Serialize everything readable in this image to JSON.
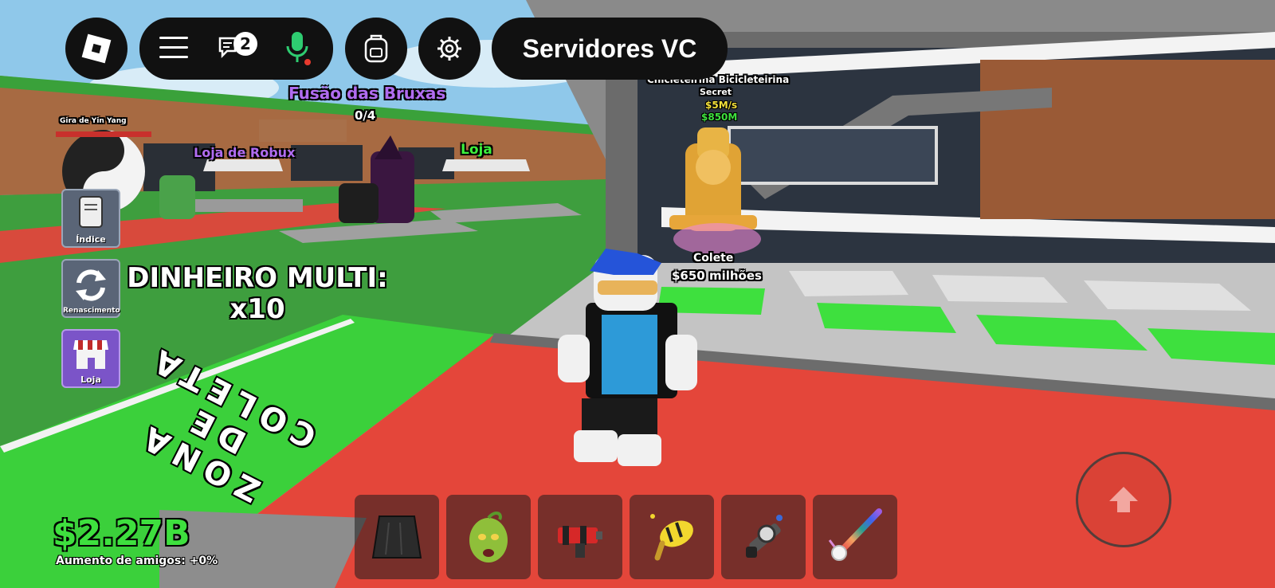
{
  "top_bar": {
    "chat_badge_count": "2",
    "server_button_label": "Servidores VC"
  },
  "world_labels": {
    "witch_fusion_title": "Fusão das Bruxas",
    "witch_fusion_progress": "0/4",
    "robux_shop": "Loja de Robux",
    "shop": "Loja",
    "yin_yang_spin": "Gira de Yin Yang",
    "brainrot_name": "Chicleteirina Bicicleteirina",
    "brainrot_rarity": "Secret",
    "brainrot_rate": "$5M/s",
    "brainrot_price": "$850M",
    "collect_label": "Colete",
    "collect_amount": "$650 milhões"
  },
  "side_menu": {
    "index_label": "Índice",
    "rebirth_label": "Renascimento",
    "shop_label": "Loja"
  },
  "money_multi": {
    "line1": "DINHEIRO MULTI:",
    "line2": "x10"
  },
  "floor_text": {
    "line1": "ZONA",
    "line2": "DE",
    "line3": "COLETA"
  },
  "stats": {
    "cash": "$2.27B",
    "friend_boost": "Aumento de amigos: +0%"
  },
  "hotbar": {
    "slots": [
      "cape",
      "zombie-head",
      "red-blaster",
      "bee-launcher",
      "web-slinger",
      "unicorn-rainbow-sword"
    ]
  },
  "colors": {
    "hud_bg": "#111111",
    "cash_green": "#3ee03e",
    "mic_green": "#2ecc71",
    "witch_purple": "#b06cf0",
    "shop_green": "#3cf03c",
    "red_floor": "#e4463a",
    "green_zone": "#3cd03c"
  }
}
